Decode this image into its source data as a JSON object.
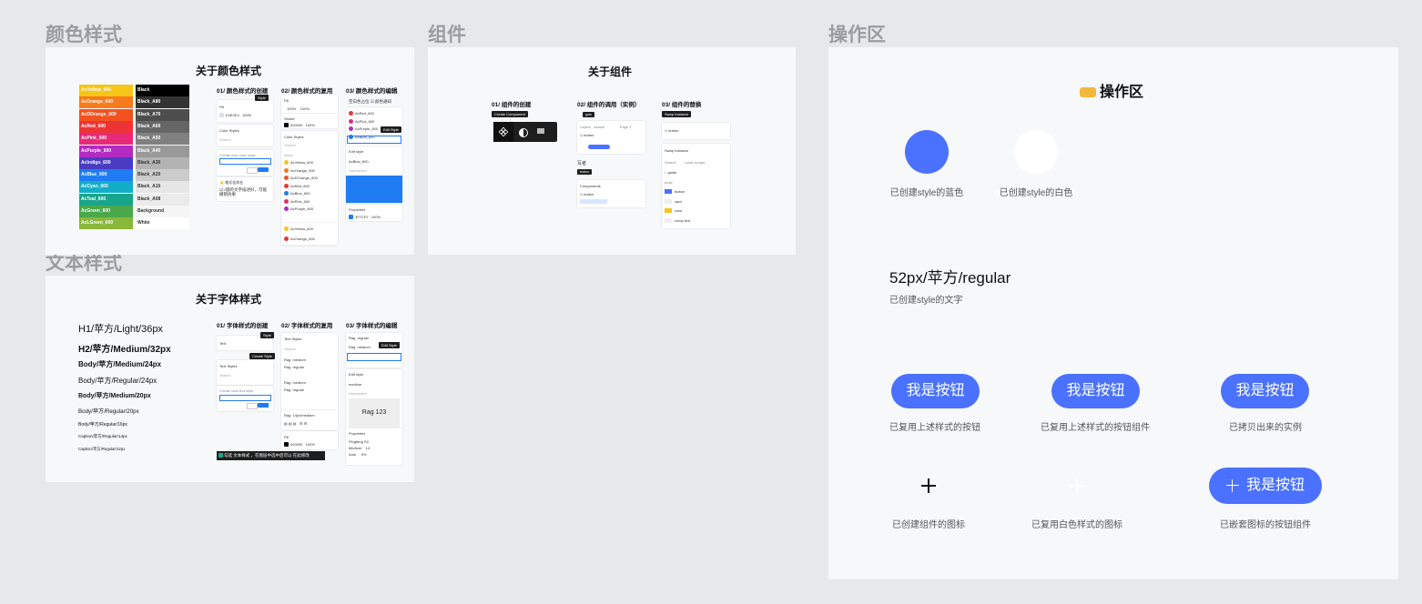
{
  "frames": {
    "color": "颜色样式",
    "component": "组件",
    "operation": "操作区",
    "text": "文本样式"
  },
  "color_panel": {
    "title": "关于颜色样式",
    "sections": [
      "01/  颜色样式的创建",
      "02/  颜色样式的复用",
      "03/  颜色样式的编辑"
    ],
    "swatches": [
      {
        "name": "AcYellow_600",
        "color": "#f5c518"
      },
      {
        "name": "AcOrange_600",
        "color": "#f77b1d"
      },
      {
        "name": "AcDOrange_600",
        "color": "#f2521f"
      },
      {
        "name": "AcRed_600",
        "color": "#ec3436"
      },
      {
        "name": "AcPink_600",
        "color": "#e72a77"
      },
      {
        "name": "AcPurple_600",
        "color": "#b42ac2"
      },
      {
        "name": "AcIndigo_600",
        "color": "#4a3cc0"
      },
      {
        "name": "AcBlue_600",
        "color": "#1f7cf2"
      },
      {
        "name": "AcCyan_600",
        "color": "#12aec9"
      },
      {
        "name": "AcTeal_600",
        "color": "#19a58b"
      },
      {
        "name": "AcGreen_600",
        "color": "#4aa84b"
      },
      {
        "name": "AcLGreen_600",
        "color": "#8ab83a"
      }
    ],
    "blacks": [
      {
        "name": "Black",
        "color": "#000000"
      },
      {
        "name": "Black_A80",
        "color": "#333333"
      },
      {
        "name": "Black_A70",
        "color": "#4d4d4d"
      },
      {
        "name": "Black_A60",
        "color": "#666666"
      },
      {
        "name": "Black_A50",
        "color": "#808080"
      },
      {
        "name": "Black_A40",
        "color": "#999999"
      },
      {
        "name": "Black_A30",
        "color": "#b3b3b3"
      },
      {
        "name": "Black_A20",
        "color": "#cccccc"
      },
      {
        "name": "Black_A10",
        "color": "#e6e6e6"
      },
      {
        "name": "Black_A08",
        "color": "#ebebeb"
      },
      {
        "name": "Background",
        "color": "#f5f5f5"
      },
      {
        "name": "White",
        "color": "#ffffff"
      }
    ],
    "tip_style": "Style",
    "tip_edit": "Edit Style",
    "color_styles": "Color Styles",
    "note": "以√圆的文字描述好，可能撤销效果",
    "list2": [
      "AcYellow_600",
      "AcOrange_600",
      "AcDOrange_600",
      "AcRed_600",
      "AcBlue_600",
      "AcPink_600",
      "AcPurple_600"
    ],
    "list3": [
      "AcRed_600",
      "AcPink_600",
      "AcPurple_600",
      "AcBlue_600"
    ]
  },
  "component_panel": {
    "title": "关于组件",
    "sections": [
      "01/  组件的创建",
      "02/  组件的调用（实例）",
      "03/  组件的替换"
    ],
    "tip_create": "Create Component",
    "tip_swap": "Swap Instance",
    "items": [
      "button",
      "card",
      "color",
      "comp text"
    ]
  },
  "text_panel": {
    "title": "关于字体样式",
    "sections": [
      "01/  字体样式的创建",
      "02/  字体样式的复用",
      "03/  字体样式的编辑"
    ],
    "samples": [
      "H1/苹方/Light/36px",
      "H2/苹方/Medium/32px",
      "Body/苹方/Medium/24px",
      "Body/苹方/Regular/24px",
      "Body/苹方/Medium/20px",
      "Body/苹方/Regular/20px",
      "Body/苹方/Regular/16px",
      "Caption/苹方/Regular/14px",
      "Caption/苹方/Regular/12px"
    ],
    "tip_create": "Create Style",
    "tip_edit": "Edit Style",
    "preview": "Rag 123",
    "footer_note": "勾选 文本样式 ，在图层中选中后可以 在此修改"
  },
  "operation": {
    "title": "操作区",
    "icon": "hand-pointing-icon",
    "blue_label": "已创建style的蓝色",
    "white_label": "已创建style的白色",
    "text_sample": "52px/苹方/regular",
    "text_label": "已创建style的文字",
    "button_text": "我是按钮",
    "btn1_label": "已复用上述样式的按钮",
    "btn2_label": "已复用上述样式的按钮组件",
    "btn3_label": "已拷贝出来的实例",
    "plus_label": "已创建组件的图标",
    "white_plus_label": "已复用白色样式的图标",
    "icon_btn_label": "已嵌套图标的按钮组件",
    "blue": "#4a71ff",
    "white": "#ffffff"
  }
}
